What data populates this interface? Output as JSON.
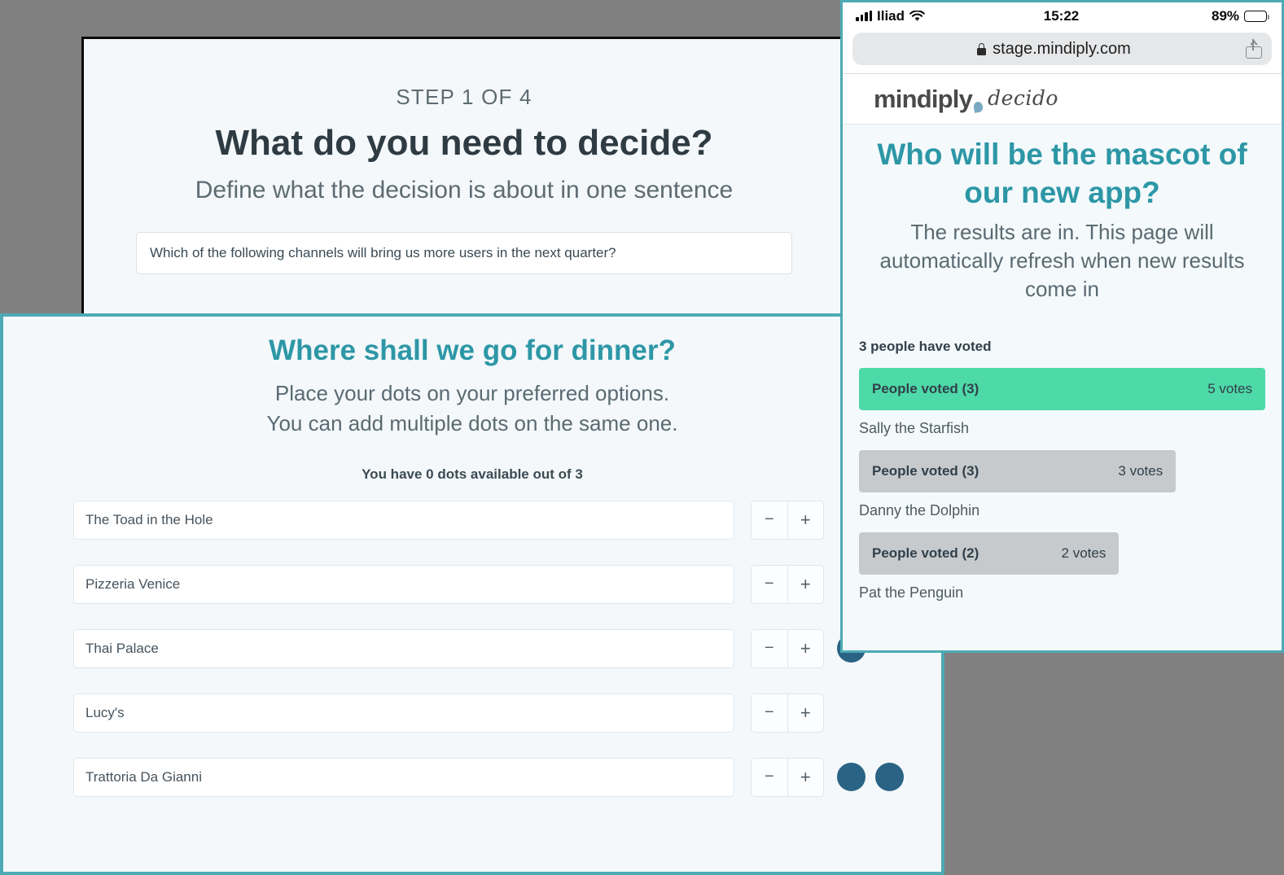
{
  "colors": {
    "backdrop": "#808080",
    "teal_accent": "#2d97a6",
    "teal_border": "#4eaab4",
    "panel_bg": "#f4f8fb",
    "winner_green": "#4ed9a8",
    "bar_gray": "#c6cacd",
    "dot_blue": "#2a6384",
    "brand_dark": "#4a4a4a",
    "brand_dot_blue": "#7aa9c4"
  },
  "step_panel": {
    "step_label": "STEP 1 OF 4",
    "title": "What do you need to decide?",
    "subtitle": "Define what the decision is about in one sentence",
    "input_value": "Which of the following channels will bring us more users in the next quarter?",
    "input_placeholder": "Define what the decision is about in one sentence"
  },
  "dot_panel": {
    "title": "Where shall we go for dinner?",
    "subtitle_line1": "Place your dots on your preferred options.",
    "subtitle_line2": "You can add multiple dots on the same one.",
    "dots_available": "You have 0 dots available out of 3",
    "minus_label": "−",
    "plus_label": "+",
    "options": [
      {
        "name": "The Toad in the Hole",
        "dots": 0
      },
      {
        "name": "Pizzeria Venice",
        "dots": 0
      },
      {
        "name": "Thai Palace",
        "dots": 1
      },
      {
        "name": "Lucy's",
        "dots": 0
      },
      {
        "name": "Trattoria Da Gianni",
        "dots": 2
      }
    ]
  },
  "phone": {
    "status_bar": {
      "carrier": "Iliad",
      "time": "15:22",
      "battery_percent": "89%",
      "battery_level": 89,
      "signal_icon": "signal-bars-icon",
      "wifi_icon": "wifi-icon",
      "battery_icon": "battery-icon"
    },
    "browser": {
      "url": "stage.mindiply.com",
      "lock_icon": "lock-icon",
      "share_icon": "share-icon"
    },
    "brand": {
      "main": "mindiply",
      "alt": "decido",
      "dot_icon": "brand-teardrop-icon"
    },
    "page": {
      "title": "Who will be the mascot of our new app?",
      "subtitle": "The results are in. This page will automatically refresh when new results come in",
      "voted_count": "3 people have voted",
      "results": [
        {
          "voters": "People voted (3)",
          "votes": "5 votes",
          "label": "Sally the Starfish",
          "width_pct": 100,
          "winner": true
        },
        {
          "voters": "People voted (3)",
          "votes": "3 votes",
          "label": "Danny the Dolphin",
          "width_pct": 78,
          "winner": false
        },
        {
          "voters": "People voted (2)",
          "votes": "2 votes",
          "label": "Pat the Penguin",
          "width_pct": 64,
          "winner": false
        }
      ]
    }
  }
}
